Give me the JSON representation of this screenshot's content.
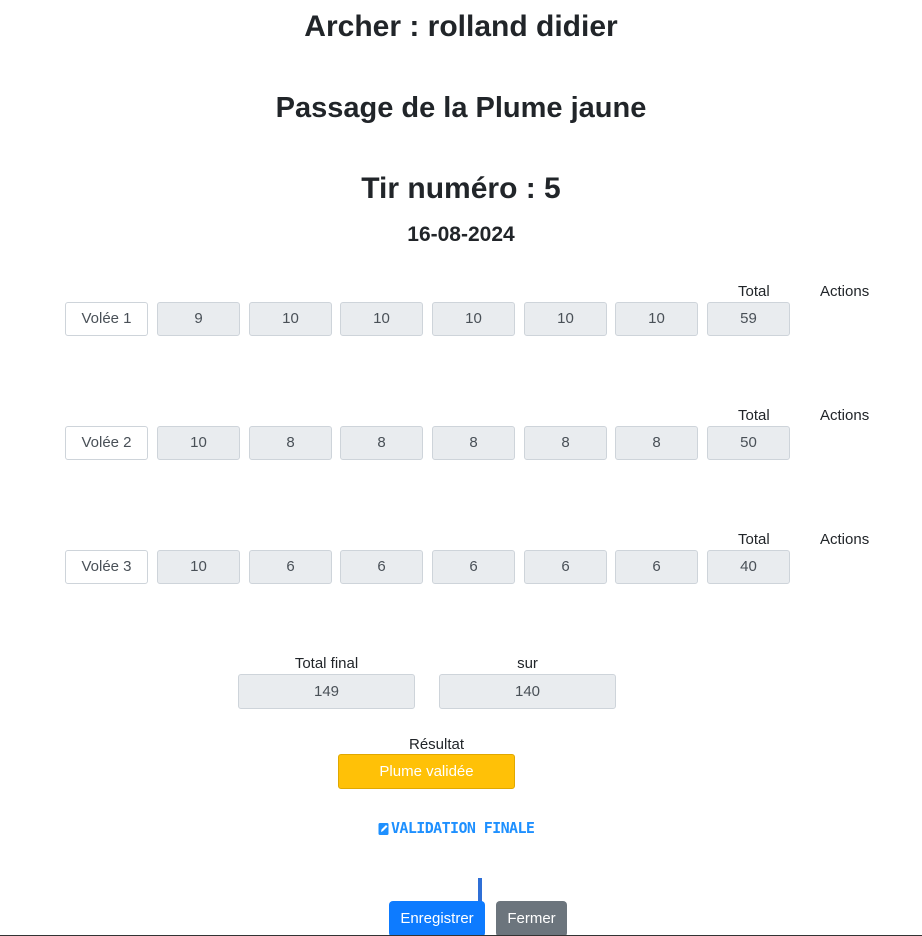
{
  "header": {
    "archer": "Archer : rolland didier",
    "passage": "Passage de la Plume jaune",
    "tir": "Tir numéro : 5",
    "date": "16-08-2024"
  },
  "volees": [
    {
      "label": "Volée 1",
      "scores": [
        "9",
        "10",
        "10",
        "10",
        "10",
        "10"
      ],
      "total": "59",
      "total_header": "Total",
      "actions_header": "Actions"
    },
    {
      "label": "Volée 2",
      "scores": [
        "10",
        "8",
        "8",
        "8",
        "8",
        "8"
      ],
      "total": "50",
      "total_header": "Total",
      "actions_header": "Actions"
    },
    {
      "label": "Volée 3",
      "scores": [
        "10",
        "6",
        "6",
        "6",
        "6",
        "6"
      ],
      "total": "40",
      "total_header": "Total",
      "actions_header": "Actions"
    }
  ],
  "summary": {
    "total_final_label": "Total final",
    "total_final_value": "149",
    "sur_label": "sur",
    "sur_value": "140",
    "result_label": "Résultat",
    "result_value": "Plume validée",
    "result_color": "#ffc107"
  },
  "validation": {
    "label": "VALIDATION FINALE",
    "icon": "pencil-square-icon",
    "color": "#1e90ff"
  },
  "footer": {
    "save_label": "Enregistrer",
    "close_label": "Fermer"
  }
}
